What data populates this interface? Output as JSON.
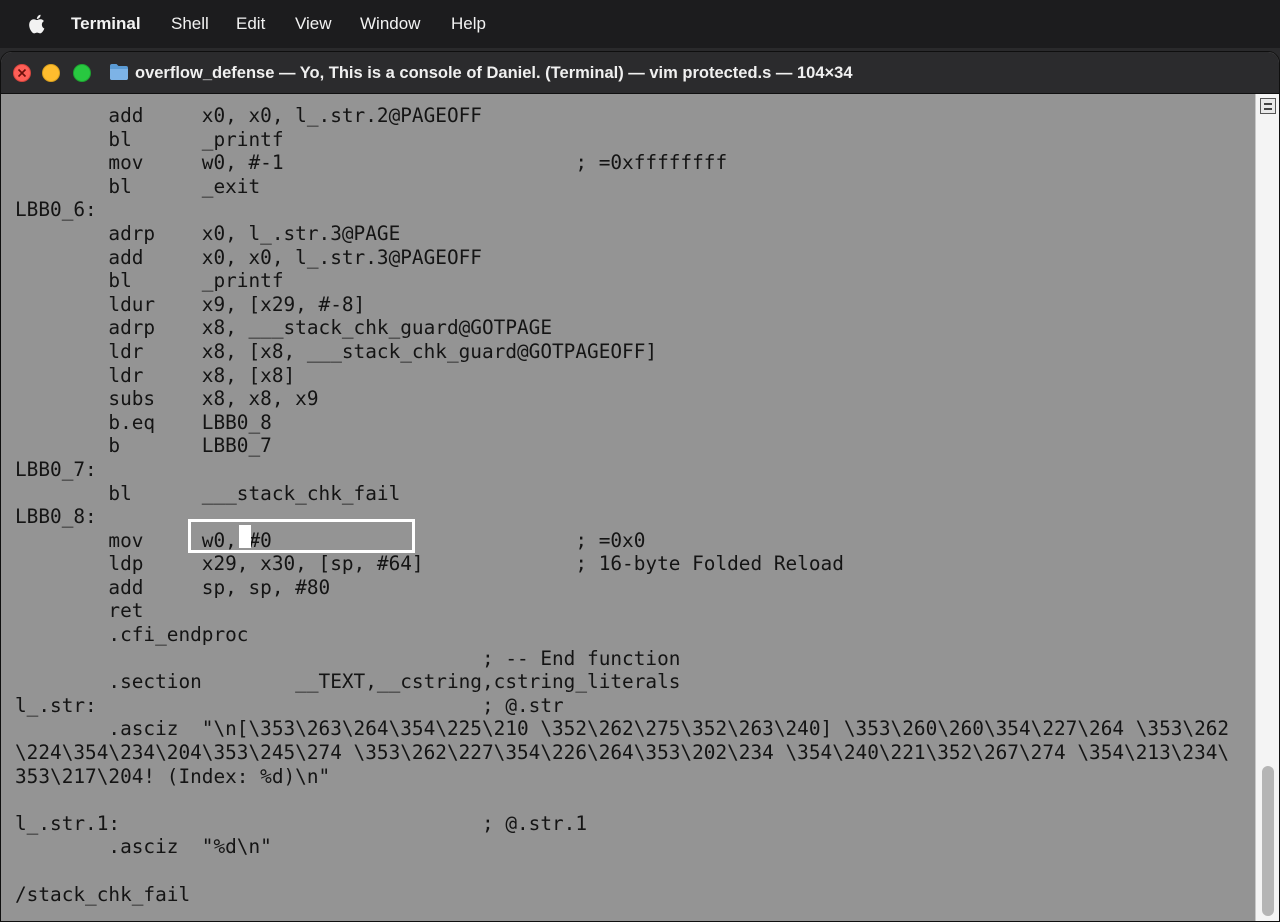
{
  "menubar": {
    "apple_icon": "apple-icon",
    "items": [
      "Terminal",
      "Shell",
      "Edit",
      "View",
      "Window",
      "Help"
    ]
  },
  "window": {
    "title": "overflow_defense — Yo, This is a console of Daniel. (Terminal) — vim protected.s — 104×34",
    "folder_icon": "folder-icon",
    "colors": {
      "close": "#fe5f57",
      "minimize": "#febc2e",
      "zoom": "#28c840",
      "terminal_background": "#949494",
      "terminal_text": "#141414"
    }
  },
  "terminal": {
    "lines": [
      "        add     x0, x0, l_.str.2@PAGEOFF",
      "        bl      _printf",
      "        mov     w0, #-1                         ; =0xffffffff",
      "        bl      _exit",
      "LBB0_6:",
      "        adrp    x0, l_.str.3@PAGE",
      "        add     x0, x0, l_.str.3@PAGEOFF",
      "        bl      _printf",
      "        ldur    x9, [x29, #-8]",
      "        adrp    x8, ___stack_chk_guard@GOTPAGE",
      "        ldr     x8, [x8, ___stack_chk_guard@GOTPAGEOFF]",
      "        ldr     x8, [x8]",
      "        subs    x8, x8, x9",
      "        b.eq    LBB0_8",
      "        b       LBB0_7",
      "LBB0_7:",
      "        bl      ___stack_chk_fail",
      "LBB0_8:",
      "        mov     w0, #0                          ; =0x0",
      "        ldp     x29, x30, [sp, #64]             ; 16-byte Folded Reload",
      "        add     sp, sp, #80",
      "        ret",
      "        .cfi_endproc",
      "                                        ; -- End function",
      "        .section        __TEXT,__cstring,cstring_literals",
      "l_.str:                                 ; @.str",
      "        .asciz  \"\\n[\\353\\263\\264\\354\\225\\210 \\352\\262\\275\\352\\263\\240] \\353\\260\\260\\354\\227\\264 \\353\\262",
      "\\224\\354\\234\\204\\353\\245\\274 \\353\\262\\227\\354\\226\\264\\353\\202\\234 \\354\\240\\221\\352\\267\\274 \\354\\213\\234\\",
      "353\\217\\204! (Index: %d)\\n\"",
      "",
      "l_.str.1:                               ; @.str.1",
      "        .asciz  \"%d\\n\"",
      "",
      "/stack_chk_fail"
    ]
  }
}
